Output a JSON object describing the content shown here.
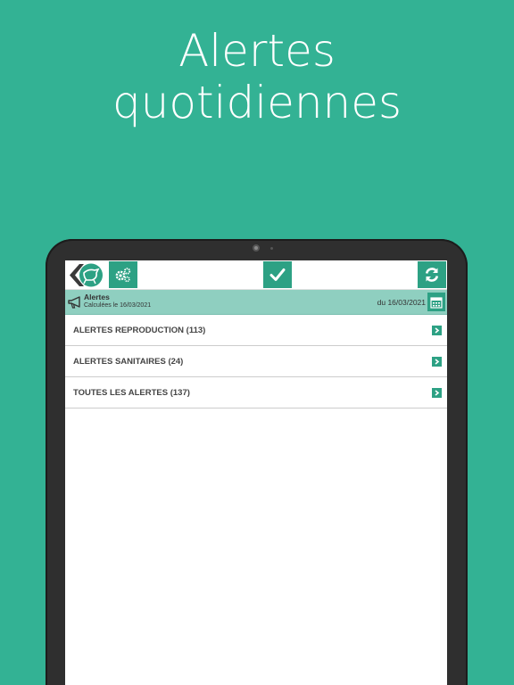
{
  "headline": {
    "line1": "Alertes",
    "line2": "quotidiennes"
  },
  "colors": {
    "background": "#33b294",
    "accent": "#2da184",
    "subbar": "#8fcfc0"
  },
  "topbar": {
    "icons": [
      "logo",
      "gears-icon",
      "check-icon",
      "refresh-icon"
    ]
  },
  "subbar": {
    "title": "Alertes",
    "calc_label": "Calculées le 16/03/2021",
    "date_label": "du 16/03/2021"
  },
  "list": {
    "items": [
      {
        "label": "ALERTES REPRODUCTION (113)"
      },
      {
        "label": "ALERTES SANITAIRES (24)"
      },
      {
        "label": "TOUTES LES ALERTES (137)"
      }
    ]
  }
}
